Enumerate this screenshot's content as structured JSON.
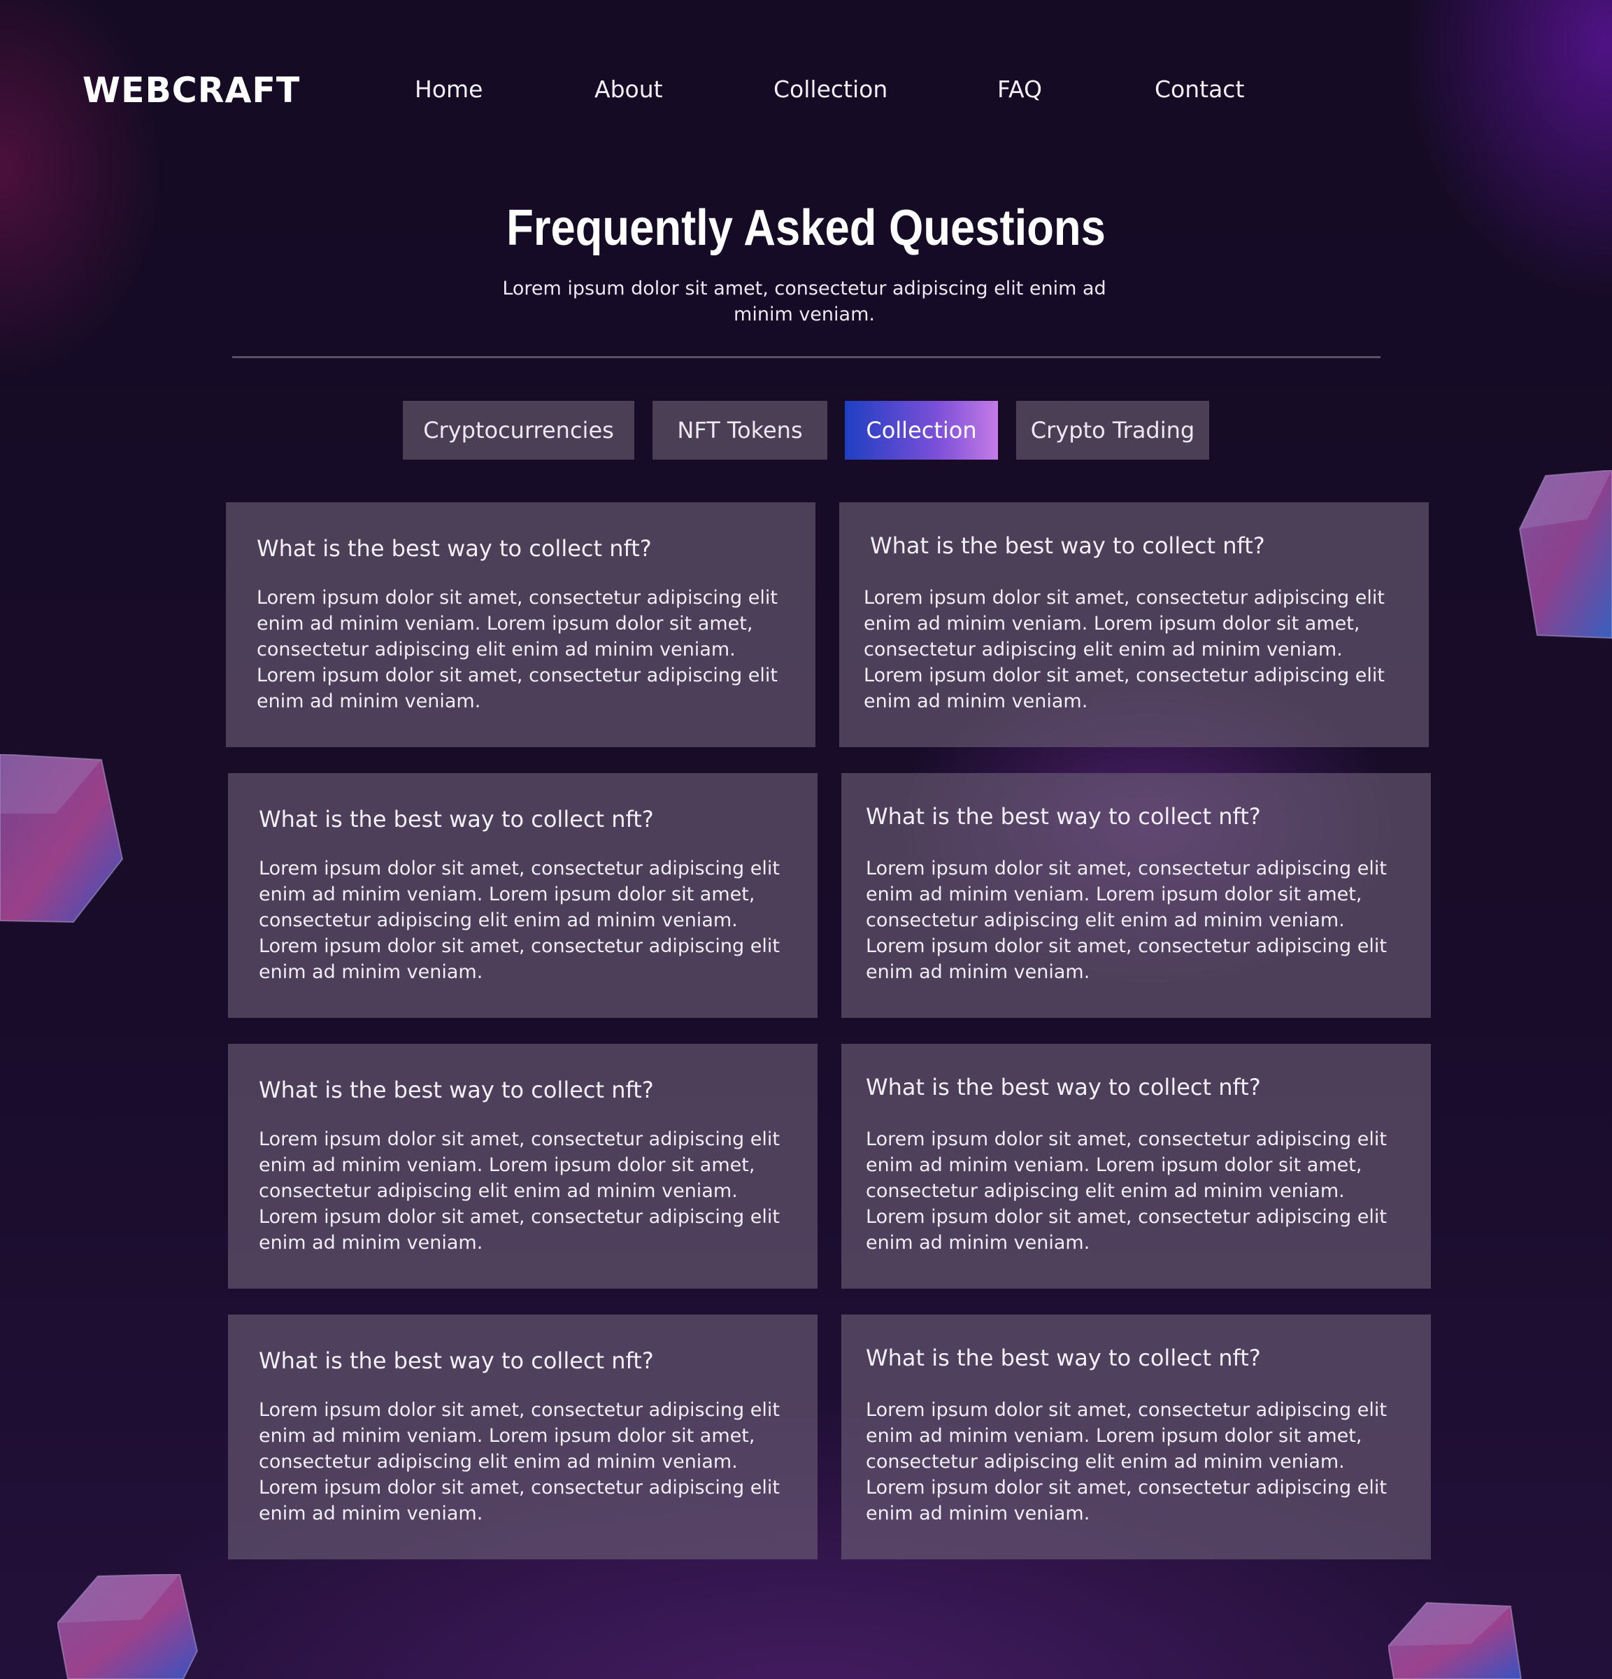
{
  "header": {
    "logo": "WEBCRAFT",
    "nav": [
      "Home",
      "About",
      "Collection",
      "FAQ",
      "Contact"
    ]
  },
  "hero": {
    "title": "Frequently Asked Questions",
    "subtitle": "Lorem ipsum dolor sit amet, consectetur adipiscing elit enim ad minim veniam."
  },
  "tabs": {
    "items": [
      "Cryptocurrencies",
      "NFT Tokens",
      "Collection",
      "Crypto Trading"
    ],
    "active": "Collection"
  },
  "faq": [
    {
      "question": "What is the best way to collect nft?",
      "answer": "Lorem ipsum dolor sit amet, consectetur adipiscing elit enim ad minim veniam. Lorem ipsum dolor sit amet, consectetur adipiscing elit enim ad minim veniam. Lorem ipsum dolor sit amet, consectetur adipiscing elit enim ad minim veniam."
    },
    {
      "question": "What is the best way to collect nft?",
      "answer": "Lorem ipsum dolor sit amet, consectetur adipiscing elit enim ad minim veniam. Lorem ipsum dolor sit amet, consectetur adipiscing elit enim ad minim veniam. Lorem ipsum dolor sit amet, consectetur adipiscing elit enim ad minim veniam."
    },
    {
      "question": "What is the best way to collect nft?",
      "answer": "Lorem ipsum dolor sit amet, consectetur adipiscing elit enim ad minim veniam. Lorem ipsum dolor sit amet, consectetur adipiscing elit enim ad minim veniam. Lorem ipsum dolor sit amet, consectetur adipiscing elit enim ad minim veniam."
    },
    {
      "question": "What is the best way to collect nft?",
      "answer": "Lorem ipsum dolor sit amet, consectetur adipiscing elit enim ad minim veniam. Lorem ipsum dolor sit amet, consectetur adipiscing elit enim ad minim veniam. Lorem ipsum dolor sit amet, consectetur adipiscing elit enim ad minim veniam."
    },
    {
      "question": "What is the best way to collect nft?",
      "answer": "Lorem ipsum dolor sit amet, consectetur adipiscing elit enim ad minim veniam. Lorem ipsum dolor sit amet, consectetur adipiscing elit enim ad minim veniam. Lorem ipsum dolor sit amet, consectetur adipiscing elit enim ad minim veniam."
    },
    {
      "question": "What is the best way to collect nft?",
      "answer": "Lorem ipsum dolor sit amet, consectetur adipiscing elit enim ad minim veniam. Lorem ipsum dolor sit amet, consectetur adipiscing elit enim ad minim veniam. Lorem ipsum dolor sit amet, consectetur adipiscing elit enim ad minim veniam."
    },
    {
      "question": "What is the best way to collect nft?",
      "answer": "Lorem ipsum dolor sit amet, consectetur adipiscing elit enim ad minim veniam. Lorem ipsum dolor sit amet, consectetur adipiscing elit enim ad minim veniam. Lorem ipsum dolor sit amet, consectetur adipiscing elit enim ad minim veniam."
    },
    {
      "question": "What is the best way to collect nft?",
      "answer": "Lorem ipsum dolor sit amet, consectetur adipiscing elit enim ad minim veniam. Lorem ipsum dolor sit amet, consectetur adipiscing elit enim ad minim veniam. Lorem ipsum dolor sit amet, consectetur adipiscing elit enim ad minim veniam."
    }
  ],
  "decorations": {
    "cube_icon": "glass-cube-icon"
  },
  "colors": {
    "background": "#170b26",
    "card": "#5a4d66",
    "tab": "#4b3f55",
    "active_tab_start": "#1f3fc2",
    "active_tab_end": "#c47be6",
    "divider": "#5b5064"
  }
}
